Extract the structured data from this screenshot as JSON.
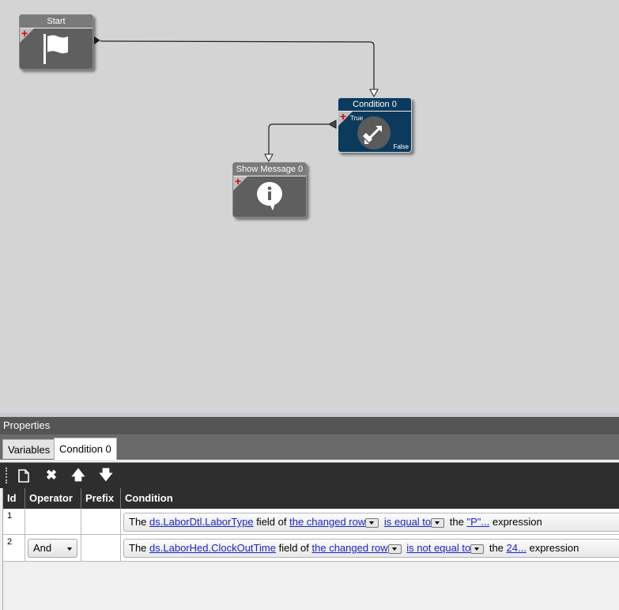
{
  "canvas": {
    "nodes": {
      "start": {
        "title": "Start",
        "icon": "flag-icon"
      },
      "condition": {
        "title": "Condition 0",
        "icon": "condition-arrows-icon",
        "true_label": "True",
        "false_label": "False"
      },
      "show_message": {
        "title": "Show Message 0",
        "icon": "info-bubble-icon"
      }
    },
    "colors": {
      "node_grey": "#5f5f5f",
      "node_blue": "#0c3a5c",
      "add_marker": "#e00000"
    }
  },
  "properties": {
    "title": "Properties",
    "tabs": [
      {
        "label": "Variables",
        "active": false
      },
      {
        "label": "Condition 0",
        "active": true
      }
    ],
    "toolbar": {
      "buttons": [
        "new-icon",
        "delete-icon",
        "move-up-icon",
        "move-down-icon"
      ]
    },
    "grid": {
      "columns": [
        "Id",
        "Operator",
        "Prefix",
        "Condition"
      ],
      "rows": [
        {
          "id": "1",
          "operator": "",
          "prefix": "",
          "condition": {
            "t1": "The",
            "field": "ds.LaborDtl.LaborType",
            "t2": "field of",
            "row": "the changed row",
            "comparison": "is equal to",
            "t3": "the",
            "value": "\"P\"...",
            "t4": "expression"
          }
        },
        {
          "id": "2",
          "operator": "And",
          "prefix": "",
          "condition": {
            "t1": "The",
            "field": "ds.LaborHed.ClockOutTime",
            "t2": "field of",
            "row": "the changed row",
            "comparison": "is not equal to",
            "t3": "the",
            "value": "24...",
            "t4": "expression"
          }
        }
      ]
    }
  }
}
